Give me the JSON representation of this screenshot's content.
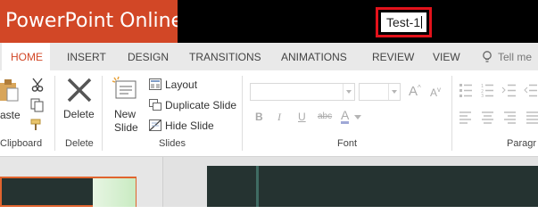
{
  "app": {
    "title": "PowerPoint Online"
  },
  "document": {
    "filename": "Test-1"
  },
  "ribbon_tabs": [
    {
      "label": "HOME",
      "active": true
    },
    {
      "label": "INSERT"
    },
    {
      "label": "DESIGN"
    },
    {
      "label": "TRANSITIONS"
    },
    {
      "label": "ANIMATIONS"
    },
    {
      "label": "REVIEW"
    },
    {
      "label": "VIEW"
    }
  ],
  "tell_me": {
    "placeholder": "Tell me"
  },
  "groups": {
    "clipboard": {
      "label": "Clipboard",
      "paste_label": "aste"
    },
    "delete": {
      "label": "Delete",
      "button_label": "Delete"
    },
    "slides": {
      "label": "Slides",
      "new_slide_line1": "New",
      "new_slide_line2": "Slide",
      "layout": "Layout",
      "duplicate": "Duplicate Slide",
      "hide": "Hide Slide"
    },
    "font": {
      "label": "Font",
      "bold": "B",
      "italic": "I",
      "underline": "U",
      "strike": "abc",
      "font_color": "A",
      "grow": "A",
      "shrink": "A"
    },
    "paragraph": {
      "label": "Paragr"
    }
  },
  "colors": {
    "brand": "#d24726",
    "highlight": "#e3121b",
    "titlebar": "#000000",
    "slide_bg": "#253331"
  }
}
